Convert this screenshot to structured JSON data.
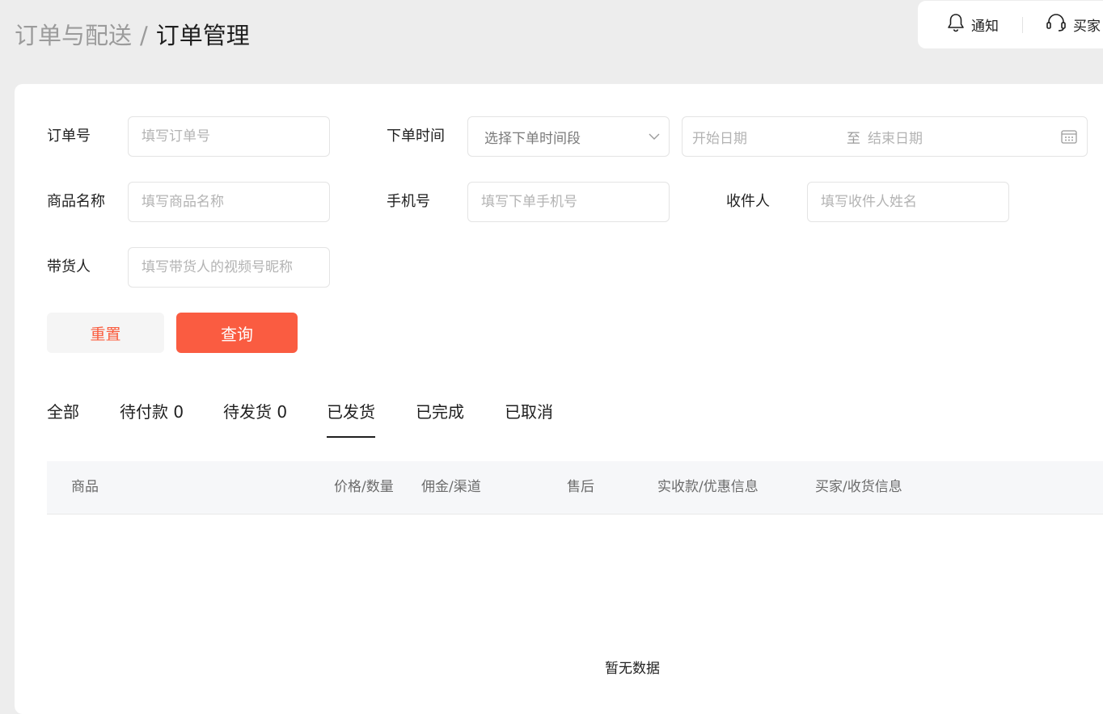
{
  "breadcrumb": {
    "parent": "订单与配送",
    "separator": "/",
    "current": "订单管理"
  },
  "topbar": {
    "notice": "通知",
    "buyer": "买家"
  },
  "filters": {
    "order_no": {
      "label": "订单号",
      "placeholder": "填写订单号"
    },
    "order_time": {
      "label": "下单时间",
      "select": "选择下单时间段",
      "start": "开始日期",
      "to": "至",
      "end": "结束日期"
    },
    "product_name": {
      "label": "商品名称",
      "placeholder": "填写商品名称"
    },
    "phone": {
      "label": "手机号",
      "placeholder": "填写下单手机号"
    },
    "receiver": {
      "label": "收件人",
      "placeholder": "填写收件人姓名"
    },
    "promoter": {
      "label": "带货人",
      "placeholder": "填写带货人的视频号昵称"
    }
  },
  "buttons": {
    "reset": "重置",
    "query": "查询"
  },
  "tabs": [
    {
      "label": "全部"
    },
    {
      "label": "待付款 0"
    },
    {
      "label": "待发货 0"
    },
    {
      "label": "已发货",
      "active": true
    },
    {
      "label": "已完成"
    },
    {
      "label": "已取消"
    }
  ],
  "table": {
    "columns": [
      "商品",
      "价格/数量",
      "佣金/渠道",
      "售后",
      "实收款/优惠信息",
      "买家/收货信息"
    ],
    "empty_text": "暂无数据"
  },
  "colors": {
    "accent": "#fa5c41",
    "background": "#ededed",
    "panel": "#ffffff",
    "table_header": "#f6f7f9"
  }
}
